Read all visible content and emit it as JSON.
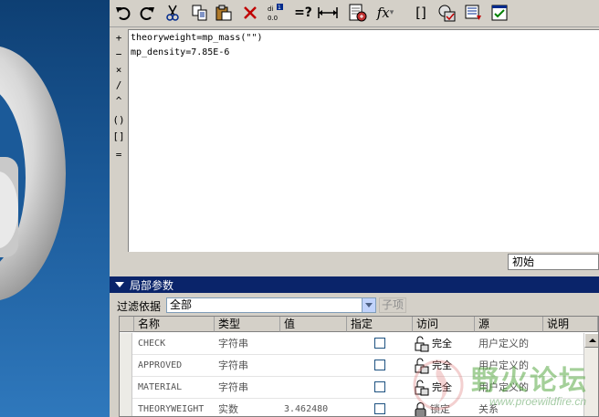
{
  "colors": {
    "titlebar": "#0a246a",
    "viewport_bg": "#1b5a99",
    "window_bg": "#d4d0c8",
    "watermark": "#5aaa46"
  },
  "toolbar": {
    "icons": [
      "undo-icon",
      "redo-icon",
      "cut-icon",
      "copy-icon",
      "paste-icon",
      "delete-icon",
      "units-icon",
      "evaluate-icon",
      "measure-icon",
      "insert-param-icon",
      "function-icon",
      "brackets-icon",
      "verify-icon",
      "sort-icon",
      "checklist-icon"
    ],
    "function_label": "fx",
    "evaluate_label": "=?",
    "brackets_label": "[]"
  },
  "operators": [
    "+",
    "−",
    "×",
    "/",
    "^",
    "()",
    "[]",
    "="
  ],
  "editor": {
    "lines": [
      "theoryweight=mp_mass(\"\")",
      "mp_density=7.85E-6"
    ]
  },
  "initial_combo": {
    "value": "初始"
  },
  "local_params": {
    "title": "局部参数",
    "filter_label": "过滤依据",
    "filter_value": "全部",
    "sub_items_label": "子项",
    "columns": [
      "名称",
      "类型",
      "值",
      "指定",
      "访问",
      "源",
      "说明"
    ],
    "rows": [
      {
        "name": "CHECK",
        "type": "字符串",
        "value": "",
        "access": "完全",
        "source": "用户定义的"
      },
      {
        "name": "APPROVED",
        "type": "字符串",
        "value": "",
        "access": "完全",
        "source": "用户定义的"
      },
      {
        "name": "MATERIAL",
        "type": "字符串",
        "value": "",
        "access": "完全",
        "source": "用户定义的"
      },
      {
        "name": "THEORYWEIGHT",
        "type": "实数",
        "value": "3.462480",
        "access": "锁定",
        "source": "关系"
      }
    ]
  },
  "watermark": {
    "title": "野火论坛",
    "url": "www.proewildfire.cn"
  }
}
